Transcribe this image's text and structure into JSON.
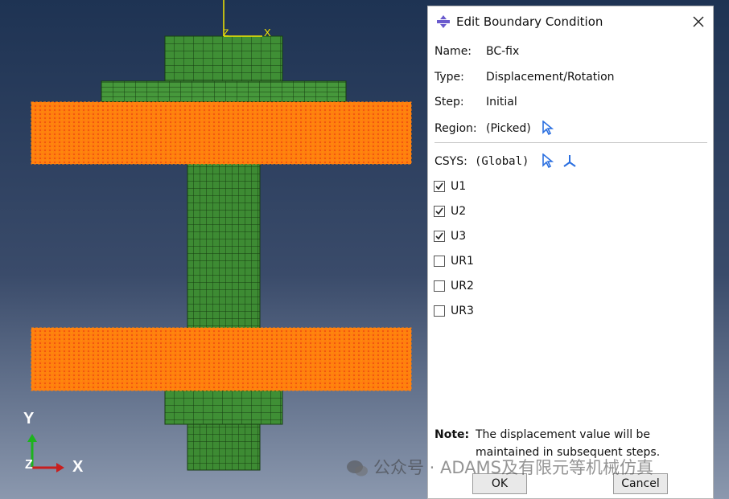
{
  "viewport": {
    "axis_triad": {
      "y_label": "Y",
      "x_label": "X",
      "z_label": "Z"
    },
    "origin_marker": {
      "z_label": "Z",
      "x_label": "X"
    },
    "colors": {
      "mesh_green": "#3f8f35",
      "mesh_line": "#173d12",
      "highlight_orange": "#ff7f0e",
      "triad_y": "#1db31d",
      "triad_x": "#c81e1e"
    }
  },
  "dialog": {
    "title": "Edit Boundary Condition",
    "fields": {
      "name_label": "Name:",
      "name_value": "BC-fix",
      "type_label": "Type:",
      "type_value": "Displacement/Rotation",
      "step_label": "Step:",
      "step_value": "Initial",
      "region_label": "Region:",
      "region_value": "(Picked)",
      "csys_label": "CSYS:",
      "csys_value": "(Global)"
    },
    "dofs": [
      {
        "label": "U1",
        "checked": true
      },
      {
        "label": "U2",
        "checked": true
      },
      {
        "label": "U3",
        "checked": true
      },
      {
        "label": "UR1",
        "checked": false
      },
      {
        "label": "UR2",
        "checked": false
      },
      {
        "label": "UR3",
        "checked": false
      }
    ],
    "note_label": "Note:",
    "note_text": "The displacement value will be maintained in subsequent steps.",
    "ok_label": "OK",
    "cancel_label": "Cancel"
  },
  "watermark": "公众号 · ADAMS及有限元等机械仿真"
}
